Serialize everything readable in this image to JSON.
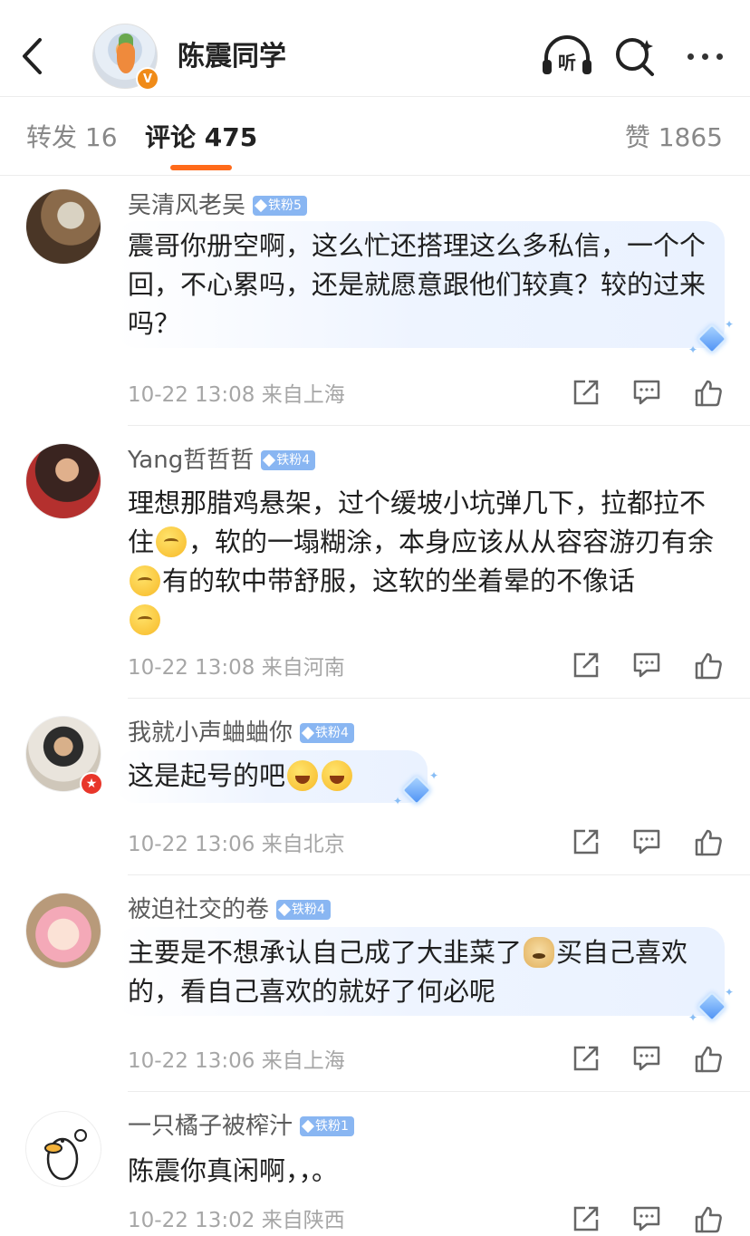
{
  "header": {
    "title": "陈震同学",
    "verified_badge": "V",
    "icons": [
      "back-icon",
      "listen-icon",
      "search-icon",
      "more-icon"
    ],
    "listen_label": "听"
  },
  "tabs": {
    "repost": "转发 16",
    "comments": "评论 475",
    "likes": "赞 1865"
  },
  "comments": [
    {
      "username": "吴清风老吴",
      "badge": "铁粉5",
      "text": "震哥你册空啊，这么忙还搭理这么多私信，一个个回，不心累吗，还是就愿意跟他们较真？较的过来吗？",
      "time": "10-22 13:08",
      "location": "来自上海"
    },
    {
      "username": "Yang哲哲哲",
      "badge": "铁粉4",
      "text_parts": [
        "理想那腊鸡悬架，过个缓坡小坑弹几下，拉都拉不住",
        "，软的一塌糊涂，本身应该从从容容游刃有余",
        "有的软中带舒服，这软的坐着晕的不像话"
      ],
      "time": "10-22 13:08",
      "location": "来自河南"
    },
    {
      "username": "我就小声蛐蛐你",
      "badge": "铁粉4",
      "text": "这是起号的吧",
      "time": "10-22 13:06",
      "location": "来自北京"
    },
    {
      "username": "被迫社交的卷",
      "badge": "铁粉4",
      "text_parts": [
        "主要是不想承认自己成了大韭菜了",
        "买自己喜欢的，看自己喜欢的就好了何必呢"
      ],
      "time": "10-22 13:06",
      "location": "来自上海"
    },
    {
      "username": "一只橘子被榨汁",
      "badge": "铁粉1",
      "text": "陈震你真闲啊，，。",
      "time": "10-22 13:02",
      "location": "来自陕西"
    }
  ],
  "colors": {
    "accent": "#ff6a1a",
    "verified": "#f08b18",
    "fan_badge": "#89b6f2",
    "meta_text": "#a6a6a6"
  }
}
